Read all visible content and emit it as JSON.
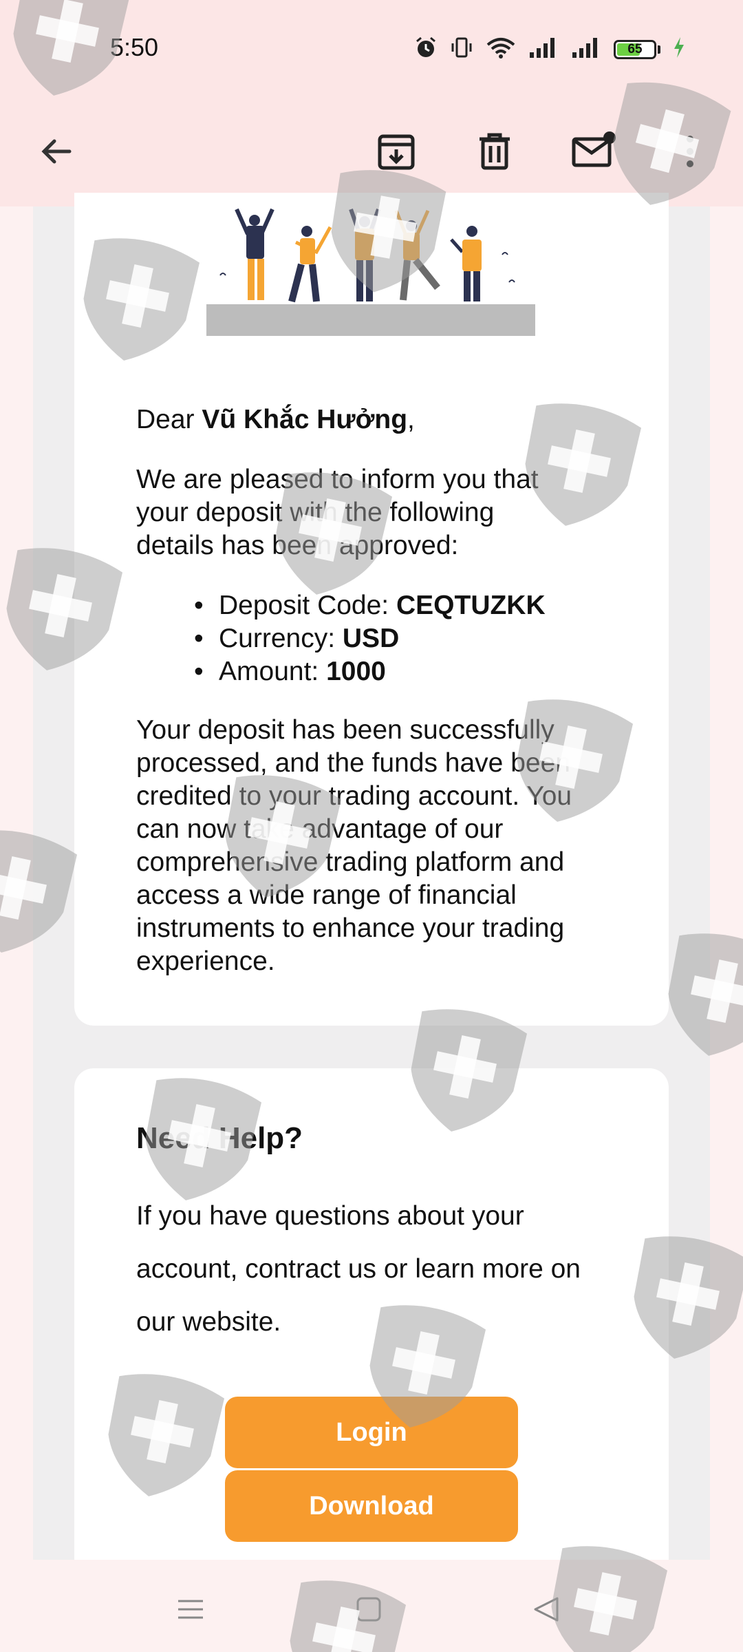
{
  "status_bar": {
    "time": "5:50",
    "battery_level": 65,
    "battery_text": "65",
    "icons": [
      "alarm-icon",
      "vibrate-icon",
      "wifi-icon",
      "signal-icon",
      "signal-icon",
      "battery-icon",
      "charging-icon"
    ]
  },
  "app_bar": {
    "icons": [
      "back-arrow-icon",
      "archive-icon",
      "delete-icon",
      "mark-unread-icon",
      "more-vert-icon"
    ]
  },
  "email": {
    "greeting_prefix": "Dear ",
    "recipient_name": "Vũ Khắc Hưởng",
    "greeting_suffix": ",",
    "intro": "We are pleased to inform you that your deposit with the following details has been approved:",
    "details": [
      {
        "label": "Deposit Code: ",
        "value": "CEQTUZKK"
      },
      {
        "label": "Currency: ",
        "value": "USD"
      },
      {
        "label": "Amount: ",
        "value": "1000"
      }
    ],
    "body": "Your deposit has been successfully processed, and the funds have been credited to your trading account. You can now take advantage of our comprehensive trading platform and access a wide range of financial instruments to enhance your trading experience."
  },
  "help": {
    "title": "Need Help?",
    "text": "If you have questions about your account, contract us or learn more on our website.",
    "login_label": "Login",
    "download_label": "Download"
  },
  "colors": {
    "accent": "#f79b2e",
    "header_bg": "#fce6e6",
    "battery": "#6ccf43",
    "watermark": "#9e9e9e"
  },
  "nav_bar": {
    "icons": [
      "menu-icon",
      "home-square-icon",
      "back-triangle-icon"
    ]
  }
}
